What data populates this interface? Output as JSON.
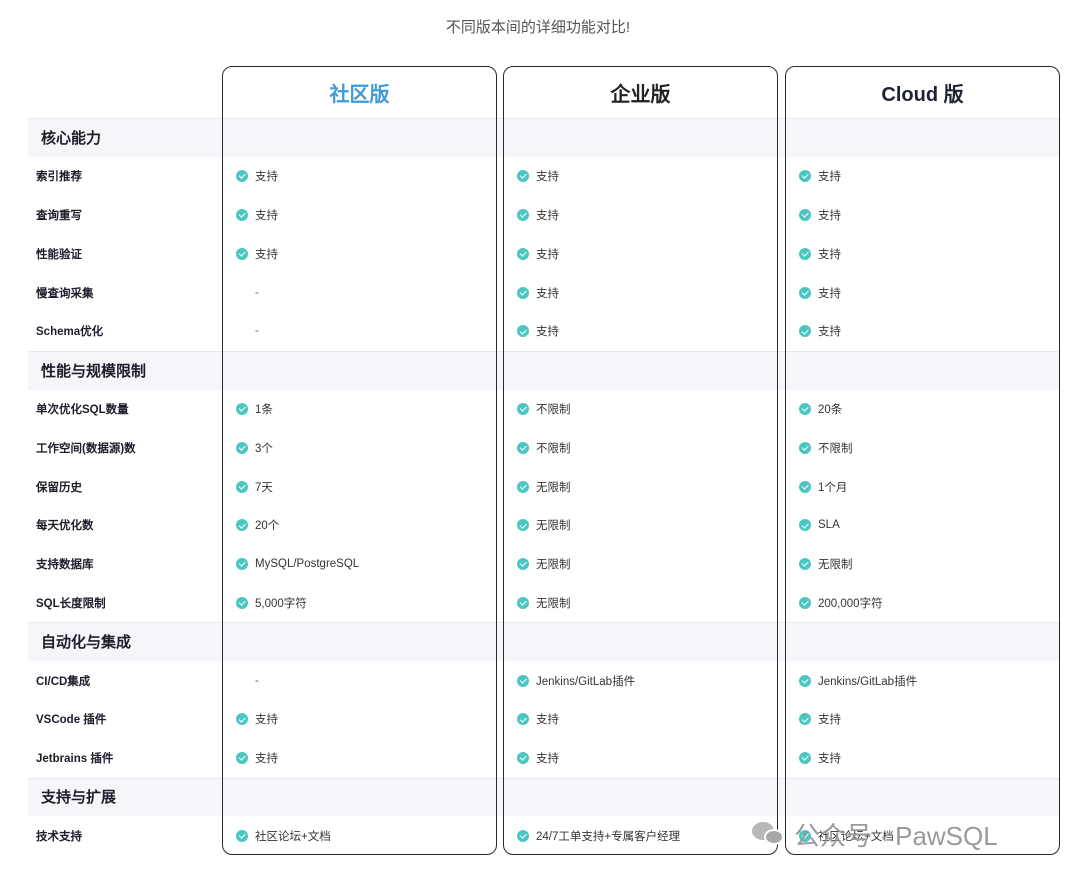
{
  "subtitle": "不同版本间的详细功能对比!",
  "columns": {
    "community": "社区版",
    "enterprise": "企业版",
    "cloud": "Cloud 版"
  },
  "colors": {
    "community_title": "#3f9ad6",
    "check": "#4cc6c0",
    "section_band": "#f4f6f9",
    "card_border": "#2a2a2a"
  },
  "sections": [
    {
      "title": "核心能力",
      "rows": [
        {
          "label": "索引推荐",
          "community": "支持",
          "enterprise": "支持",
          "cloud": "支持"
        },
        {
          "label": "查询重写",
          "community": "支持",
          "enterprise": "支持",
          "cloud": "支持"
        },
        {
          "label": "性能验证",
          "community": "支持",
          "enterprise": "支持",
          "cloud": "支持"
        },
        {
          "label": "慢查询采集",
          "community": "-",
          "enterprise": "支持",
          "cloud": "支持"
        },
        {
          "label": "Schema优化",
          "community": "-",
          "enterprise": "支持",
          "cloud": "支持"
        }
      ]
    },
    {
      "title": "性能与规模限制",
      "rows": [
        {
          "label": "单次优化SQL数量",
          "community": "1条",
          "enterprise": "不限制",
          "cloud": "20条"
        },
        {
          "label": "工作空间(数据源)数",
          "community": "3个",
          "enterprise": "不限制",
          "cloud": "不限制"
        },
        {
          "label": "保留历史",
          "community": "7天",
          "enterprise": "无限制",
          "cloud": "1个月"
        },
        {
          "label": "每天优化数",
          "community": "20个",
          "enterprise": "无限制",
          "cloud": "SLA"
        },
        {
          "label": "支持数据库",
          "community": "MySQL/PostgreSQL",
          "enterprise": "无限制",
          "cloud": "无限制"
        },
        {
          "label": "SQL长度限制",
          "community": "5,000字符",
          "enterprise": "无限制",
          "cloud": "200,000字符"
        }
      ]
    },
    {
      "title": "自动化与集成",
      "rows": [
        {
          "label": "CI/CD集成",
          "community": "-",
          "enterprise": "Jenkins/GitLab插件",
          "cloud": "Jenkins/GitLab插件"
        },
        {
          "label": "VSCode 插件",
          "community": "支持",
          "enterprise": "支持",
          "cloud": "支持"
        },
        {
          "label": "Jetbrains 插件",
          "community": "支持",
          "enterprise": "支持",
          "cloud": "支持"
        }
      ]
    },
    {
      "title": "支持与扩展",
      "rows": [
        {
          "label": "技术支持",
          "community": "社区论坛+文档",
          "enterprise": "24/7工单支持+专属客户经理",
          "cloud": "社区论坛+文档"
        }
      ]
    }
  ],
  "watermark": {
    "text": "公众号 · PawSQL",
    "icon": "wechat-icon"
  }
}
